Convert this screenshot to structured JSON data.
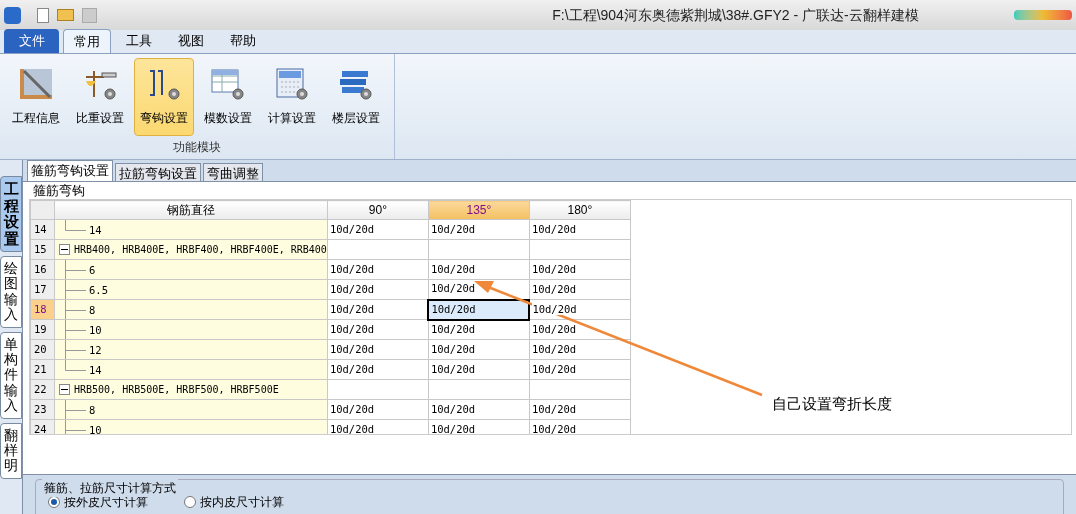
{
  "window": {
    "title": "F:\\工程\\904河东奥德紫荆城\\38#.GFY2 - 广联达-云翻样建模"
  },
  "ribbon_tabs": [
    {
      "label": "文件",
      "kind": "file",
      "selected": false
    },
    {
      "label": "常用",
      "kind": "tab",
      "selected": true
    },
    {
      "label": "工具",
      "kind": "tab",
      "selected": false
    },
    {
      "label": "视图",
      "kind": "tab",
      "selected": false
    },
    {
      "label": "帮助",
      "kind": "tab",
      "selected": false
    }
  ],
  "ribbon": {
    "group_label": "功能模块",
    "buttons": [
      {
        "label": "工程信息",
        "selected": false
      },
      {
        "label": "比重设置",
        "selected": false
      },
      {
        "label": "弯钩设置",
        "selected": true
      },
      {
        "label": "模数设置",
        "selected": false
      },
      {
        "label": "计算设置",
        "selected": false
      },
      {
        "label": "楼层设置",
        "selected": false
      }
    ]
  },
  "side_tabs": [
    {
      "label": "工程设置",
      "selected": true
    },
    {
      "label": "绘图输入",
      "selected": false
    },
    {
      "label": "单构件输入",
      "selected": false
    },
    {
      "label": "翻样明",
      "selected": false
    }
  ],
  "tabs": [
    {
      "label": "箍筋弯钩设置",
      "selected": true
    },
    {
      "label": "拉筋弯钩设置",
      "selected": false
    },
    {
      "label": "弯曲调整",
      "selected": false
    }
  ],
  "group_title": "箍筋弯钩",
  "table": {
    "columns": [
      {
        "label": "钢筋直径",
        "selected": false
      },
      {
        "label": "90°",
        "selected": false
      },
      {
        "label": "135°",
        "selected": true
      },
      {
        "label": "180°",
        "selected": false
      }
    ],
    "rows": [
      {
        "num": "14",
        "label": "14",
        "last": true,
        "selected": false,
        "values": [
          "10d/20d",
          "10d/20d",
          "10d/20d"
        ]
      },
      {
        "num": "15",
        "label": "HRB400, HRB400E, HRBF400, HRBF400E, RRB400",
        "expanded": true,
        "selected": false,
        "children": [
          {
            "num": "16",
            "label": "6",
            "last": false,
            "selected": false,
            "values": [
              "10d/20d",
              "10d/20d",
              "10d/20d"
            ]
          },
          {
            "num": "17",
            "label": "6.5",
            "last": false,
            "selected": false,
            "values": [
              "10d/20d",
              "10d/20d",
              "10d/20d"
            ]
          },
          {
            "num": "18",
            "label": "8",
            "last": false,
            "selected": true,
            "values": [
              "10d/20d",
              "10d/20d",
              "10d/20d"
            ]
          },
          {
            "num": "19",
            "label": "10",
            "last": false,
            "selected": false,
            "values": [
              "10d/20d",
              "10d/20d",
              "10d/20d"
            ]
          },
          {
            "num": "20",
            "label": "12",
            "last": false,
            "selected": false,
            "values": [
              "10d/20d",
              "10d/20d",
              "10d/20d"
            ]
          },
          {
            "num": "21",
            "label": "14",
            "last": true,
            "selected": false,
            "values": [
              "10d/20d",
              "10d/20d",
              "10d/20d"
            ]
          }
        ]
      },
      {
        "num": "22",
        "label": "HRB500, HRB500E, HRBF500, HRBF500E",
        "expanded": true,
        "selected": false,
        "children": [
          {
            "num": "23",
            "label": "8",
            "last": false,
            "selected": false,
            "values": [
              "10d/20d",
              "10d/20d",
              "10d/20d"
            ]
          },
          {
            "num": "24",
            "label": "10",
            "last": false,
            "selected": false,
            "values": [
              "10d/20d",
              "10d/20d",
              "10d/20d"
            ]
          }
        ]
      }
    ]
  },
  "annotation": {
    "text": "自己设置弯折长度"
  },
  "calc_method": {
    "title": "箍筋、拉筋尺寸计算方式",
    "options": [
      {
        "label": "按外皮尺寸计算",
        "selected": true
      },
      {
        "label": "按内皮尺寸计算",
        "selected": false
      }
    ]
  }
}
